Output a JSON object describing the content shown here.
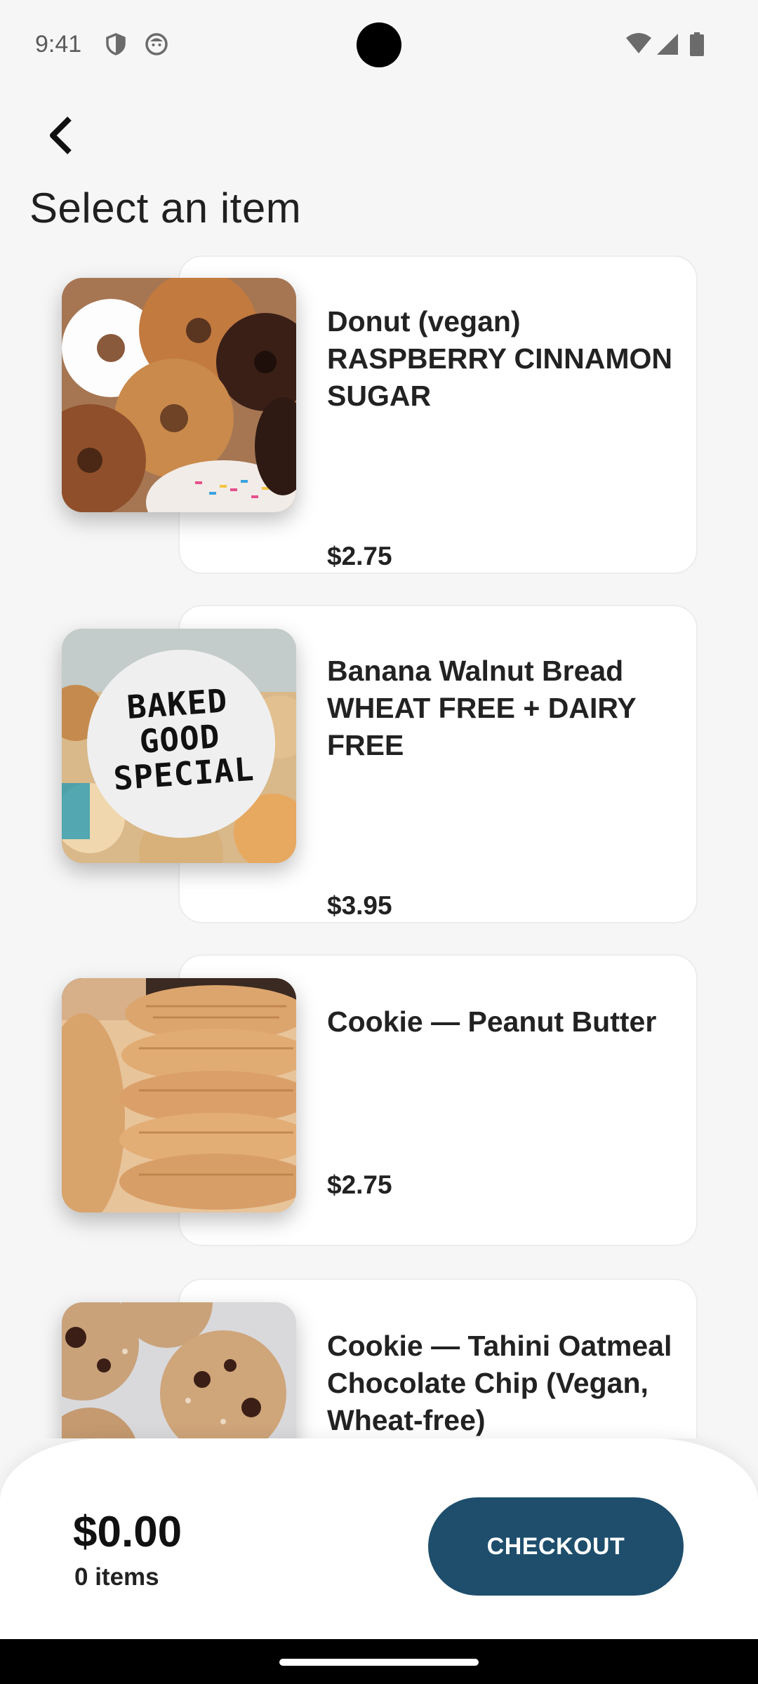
{
  "status_bar": {
    "time": "9:41",
    "icons_left": [
      "shield-icon",
      "face-icon"
    ],
    "icons_right": [
      "wifi-icon",
      "signal-icon",
      "battery-icon"
    ]
  },
  "header": {
    "back_icon": "chevron-left-icon",
    "title": "Select an item"
  },
  "items": [
    {
      "name": "Donut (vegan) RASPBERRY CINNAMON SUGAR",
      "price": "$2.75",
      "image": "donuts-photo"
    },
    {
      "name": "Banana Walnut Bread WHEAT FREE + DAIRY FREE",
      "price": "$3.95",
      "image": "baked-good-special-photo",
      "image_text": "BAKED GOOD SPECIAL"
    },
    {
      "name": "Cookie — Peanut Butter",
      "price": "$2.75",
      "image": "peanut-butter-cookies-photo"
    },
    {
      "name": "Cookie — Tahini Oatmeal Chocolate Chip (Vegan, Wheat-free)",
      "price": "",
      "image": "chocolate-chip-cookies-photo"
    }
  ],
  "checkout": {
    "total": "$0.00",
    "count": "0 items",
    "button_label": "CHECKOUT"
  },
  "colors": {
    "accent": "#1e4e6c",
    "background": "#f6f6f6",
    "card": "#ffffff"
  }
}
